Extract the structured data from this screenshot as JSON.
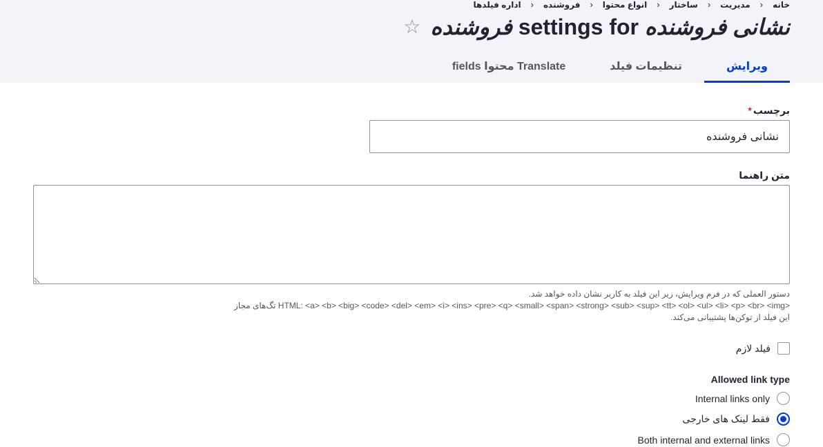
{
  "breadcrumb": [
    "خانه",
    "مدیریت",
    "ساختار",
    "انواع محتوا",
    "فروشنده",
    "اداره فیلدها"
  ],
  "breadcrumb_separator": "‹",
  "page_title": {
    "field_name": "نشانی فروشنده",
    "settings_for": "settings for",
    "bundle_name": "فروشنده"
  },
  "shortcut_icon": "star-outline-icon",
  "shortcut_glyph": "☆",
  "tabs": [
    {
      "label": "ویرایش",
      "active": true
    },
    {
      "label": "تنظیمات فیلد",
      "active": false
    },
    {
      "label": "Translate محتوا fields",
      "active": false
    }
  ],
  "form": {
    "label_field": {
      "label": "برچسب",
      "required_mark": "*",
      "value": "نشانی فروشنده"
    },
    "help_text": {
      "label": "متن راهنما",
      "value": "",
      "description_lines": [
        "دستور العملی که در فرم ویرایش، زیر این فیلد به کاربر نشان داده خواهد شد.",
        "<HTML: <a> <b> <big> <code> <del> <em> <i> <ins> <pre> <q> <small> <span> <strong> <sub> <sup> <tt> <ol> <ul> <li> <p> <br> <img تگ‌های مجاز",
        "این فیلد از توکن‌ها پشتیبانی می‌کند."
      ]
    },
    "required_checkbox": {
      "label": "فیلد لازم",
      "checked": false
    },
    "link_type": {
      "legend": "Allowed link type",
      "options": [
        {
          "label": "Internal links only",
          "checked": false
        },
        {
          "label": "فقط لینک های خارجی",
          "checked": true
        },
        {
          "label": "Both internal and external links",
          "checked": false
        }
      ]
    }
  },
  "colors": {
    "accent": "#003ecc",
    "required": "#dc2323",
    "text": "#222330",
    "header_bg": "#f3f4f9"
  }
}
